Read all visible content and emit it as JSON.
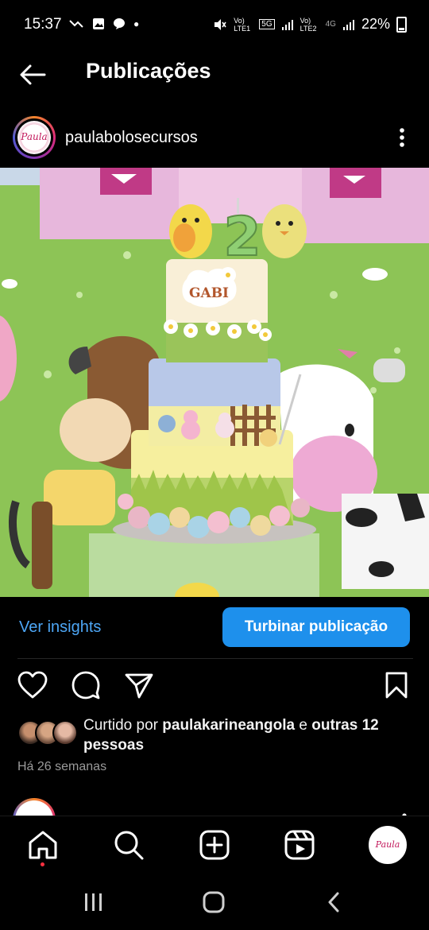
{
  "status_bar": {
    "time": "15:37",
    "network_1": "Vo) LTE1",
    "network_5g": "5G",
    "network_2": "Vo) LTE2",
    "network_4g": "4G",
    "battery": "22%"
  },
  "header": {
    "title": "Publicações"
  },
  "post": {
    "username": "paulabolosecursos",
    "avatar_text": "Paula",
    "cake_name": "GABI",
    "cake_number": "2",
    "insights_label": "Ver insights",
    "boost_label": "Turbinar publicação",
    "likes_prefix": "Curtido por ",
    "likes_user": "paulakarineangola",
    "likes_mid": " e ",
    "likes_others": "outras 12 pessoas",
    "time_ago": "Há 26 semanas"
  },
  "nav": {
    "avatar_text": "Paula"
  },
  "colors": {
    "accent": "#1e90ec",
    "link": "#4da6f5",
    "background": "#000000",
    "notification": "#ff3040"
  },
  "icons": {
    "back": "arrow-left-icon",
    "more": "more-vertical-icon",
    "like": "heart-icon",
    "comment": "comment-icon",
    "share": "send-icon",
    "save": "bookmark-icon",
    "home": "home-icon",
    "search": "search-icon",
    "create": "plus-square-icon",
    "reels": "reels-icon"
  }
}
